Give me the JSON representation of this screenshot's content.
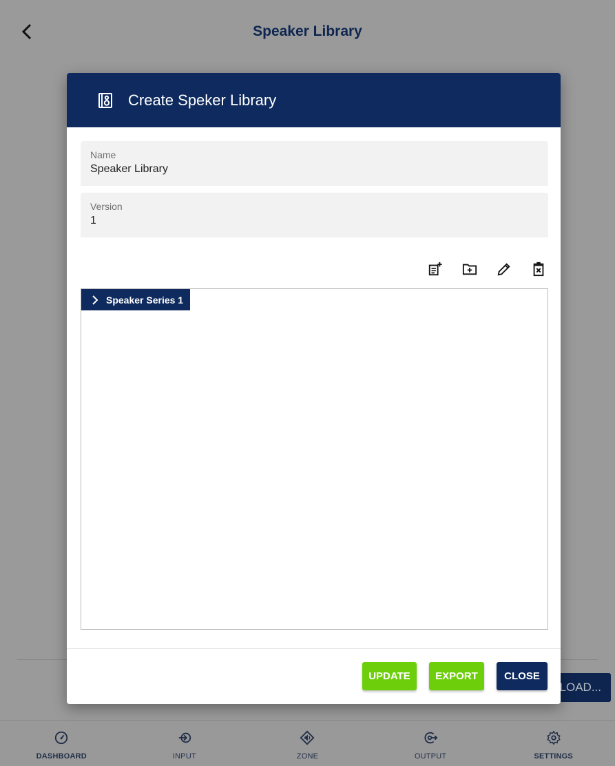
{
  "app": {
    "title": "Speaker Library",
    "back_icon": "chevron-left-icon"
  },
  "background": {
    "load_button_label": "LOAD..."
  },
  "nav": [
    {
      "label": "DASHBOARD",
      "icon": "gauge-icon"
    },
    {
      "label": "INPUT",
      "icon": "input-icon"
    },
    {
      "label": "ZONE",
      "icon": "zone-speaker-icon"
    },
    {
      "label": "OUTPUT",
      "icon": "output-icon"
    },
    {
      "label": "SETTINGS",
      "icon": "gear-icon"
    }
  ],
  "modal": {
    "title": "Create Speker Library",
    "header_icon": "speaker-icon",
    "fields": {
      "name": {
        "label": "Name",
        "value": "Speaker Library"
      },
      "version": {
        "label": "Version",
        "value": "1"
      }
    },
    "toolbar_icons": [
      "add-item-icon",
      "add-folder-icon",
      "edit-pencil-icon",
      "delete-icon"
    ],
    "tree": {
      "nodes": [
        {
          "label": "Speaker Series 1",
          "expanded": false
        }
      ]
    },
    "buttons": {
      "update": "UPDATE",
      "export": "EXPORT",
      "close": "CLOSE"
    }
  },
  "colors": {
    "navy": "#0e2a5e",
    "green": "#6dcf0b",
    "backdrop": "#9a9a9a"
  }
}
